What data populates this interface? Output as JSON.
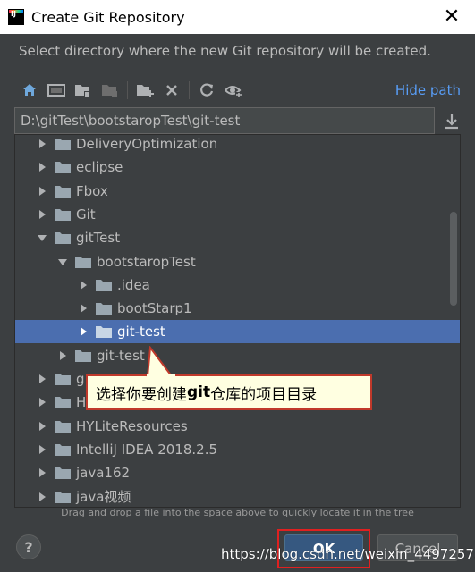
{
  "window": {
    "title": "Create Git Repository",
    "close_glyph": "✕"
  },
  "description": "Select directory where the new Git repository will be created.",
  "toolbar": {
    "icons": [
      "home-icon",
      "desktop-icon",
      "project-folder-icon",
      "module-folder-icon",
      "new-folder-icon",
      "delete-icon",
      "refresh-icon",
      "show-hidden-icon"
    ],
    "hide_path_label": "Hide path"
  },
  "path_field": {
    "value": "D:\\gitTest\\bootstaropTest\\git-test"
  },
  "tree": {
    "rows": [
      {
        "label": "DeliveryOptimization",
        "depth": 1,
        "expanded": false,
        "selected": false
      },
      {
        "label": "eclipse",
        "depth": 1,
        "expanded": false,
        "selected": false
      },
      {
        "label": "Fbox",
        "depth": 1,
        "expanded": false,
        "selected": false
      },
      {
        "label": "Git",
        "depth": 1,
        "expanded": false,
        "selected": false
      },
      {
        "label": "gitTest",
        "depth": 1,
        "expanded": true,
        "selected": false
      },
      {
        "label": "bootstaropTest",
        "depth": 2,
        "expanded": true,
        "selected": false
      },
      {
        "label": ".idea",
        "depth": 3,
        "expanded": false,
        "selected": false
      },
      {
        "label": "bootStarp1",
        "depth": 3,
        "expanded": false,
        "selected": false
      },
      {
        "label": "git-test",
        "depth": 3,
        "expanded": false,
        "selected": true
      },
      {
        "label": "git-test",
        "depth": 2,
        "expanded": false,
        "selected": false
      },
      {
        "label": "g",
        "depth": 1,
        "expanded": false,
        "selected": false
      },
      {
        "label": "H",
        "depth": 1,
        "expanded": false,
        "selected": false
      },
      {
        "label": "HYLiteResources",
        "depth": 1,
        "expanded": false,
        "selected": false
      },
      {
        "label": "IntelliJ IDEA 2018.2.5",
        "depth": 1,
        "expanded": false,
        "selected": false
      },
      {
        "label": "java162",
        "depth": 1,
        "expanded": false,
        "selected": false
      },
      {
        "label": "java视频",
        "depth": 1,
        "expanded": false,
        "selected": false
      }
    ]
  },
  "hint": "Drag and drop a file into the space above to quickly locate it in the tree",
  "help_label": "?",
  "ok_label": "OK",
  "cancel_label": "Cancel",
  "callout": {
    "prefix": "选择你要创建",
    "bold": "git",
    "suffix": "仓库的项目目录"
  },
  "watermark": "https://blog.csdn.net/weixin_44972575",
  "colors": {
    "selection": "#4b6eaf",
    "link": "#589df6",
    "background": "#3c3f41",
    "folder": "#9aa7b0"
  }
}
